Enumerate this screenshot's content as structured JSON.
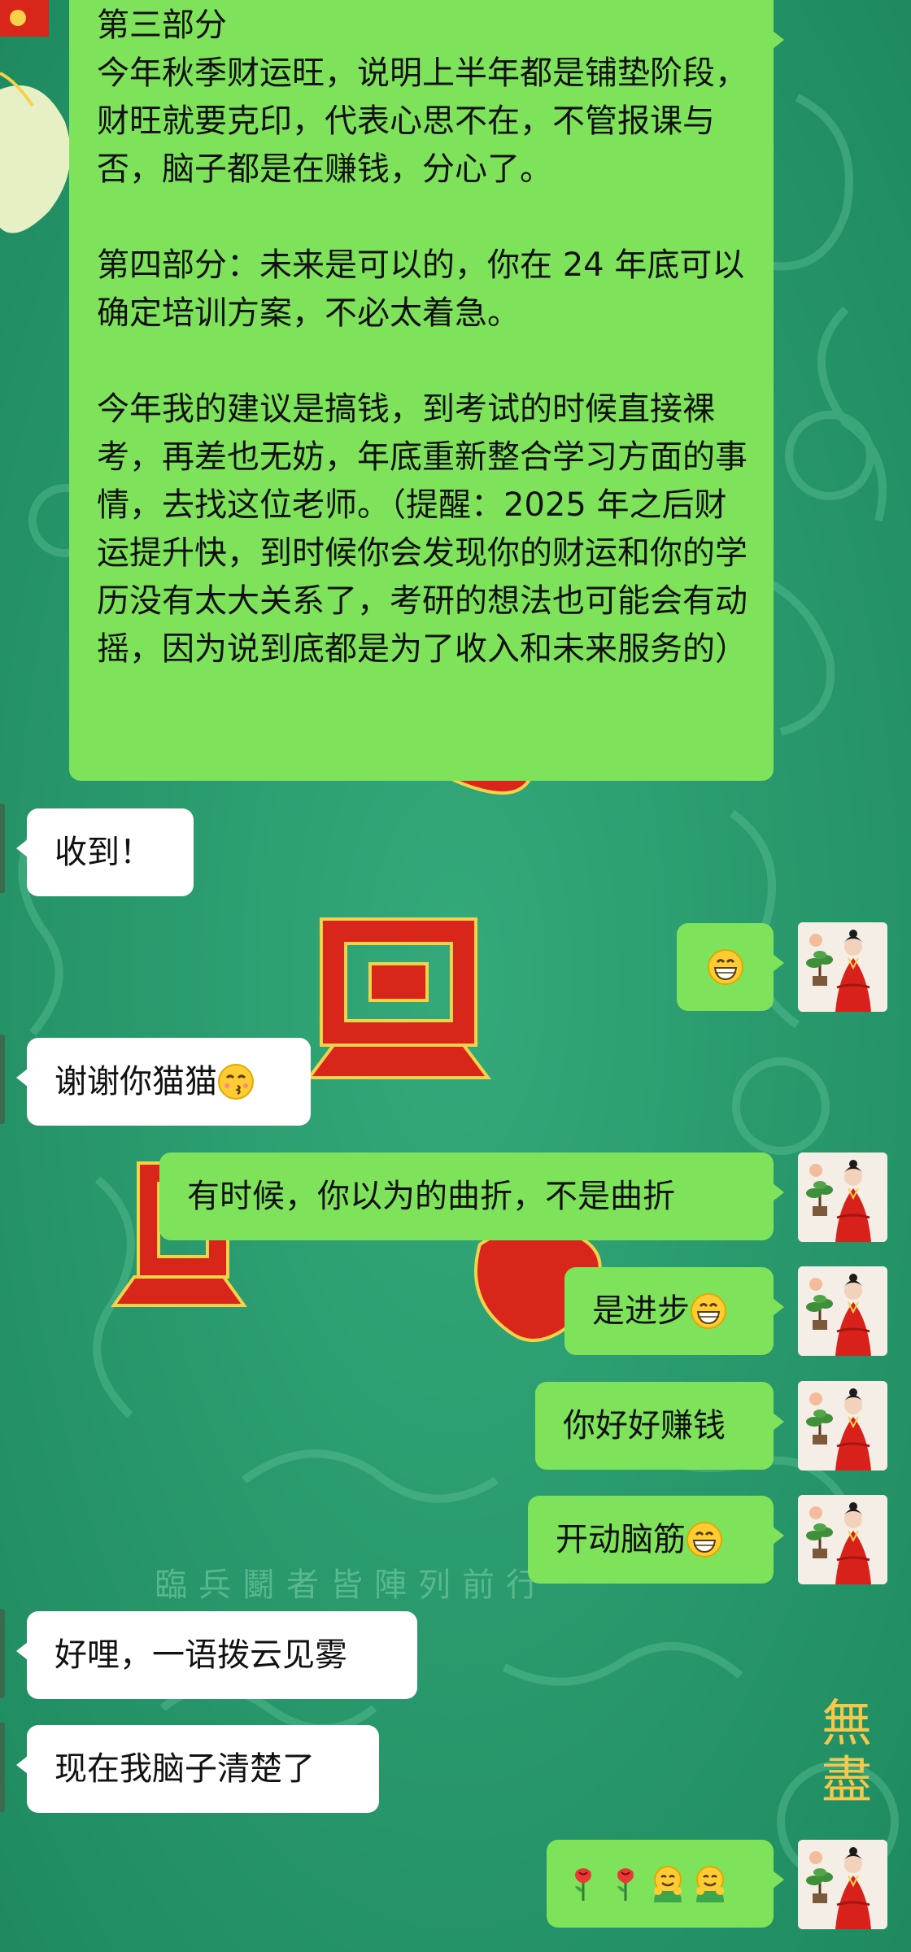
{
  "colors": {
    "wallpaper": "#2a9a6e",
    "outgoing_bubble": "#7ee35a",
    "incoming_bubble": "#ffffff",
    "wallpaper_ornament": "#d8261b"
  },
  "wallpaper_text": {
    "motto": "臨兵鬭者皆陣列前行",
    "seal": "無盡"
  },
  "messages": [
    {
      "id": "m1",
      "side": "outgoing",
      "paragraphs": [
        "第三部分\n今年秋季财运旺，说明上半年都是铺垫阶段，财旺就要克印，代表心思不在，不管报课与否，脑子都是在赚钱，分心了。",
        "第四部分：未来是可以的，你在 24 年底可以确定培训方案，不必太着急。",
        "今年我的建议是搞钱，到考试的时候直接裸考，再差也无妨，年底重新整合学习方面的事情，去找这位老师。（提醒：2025 年之后财运提升快，到时候你会发现你的财运和你的学历没有太大关系了，考研的想法也可能会有动摇，因为说到底都是为了收入和未来服务的）"
      ]
    },
    {
      "id": "m2",
      "side": "incoming",
      "text": "收到！"
    },
    {
      "id": "m3",
      "side": "outgoing",
      "text": "",
      "emojis": [
        "grinning-face"
      ]
    },
    {
      "id": "m4",
      "side": "incoming",
      "text": "谢谢你猫猫",
      "emojis": [
        "kissing-face"
      ]
    },
    {
      "id": "m5",
      "side": "outgoing",
      "text": "有时候，你以为的曲折，不是曲折"
    },
    {
      "id": "m6",
      "side": "outgoing",
      "text": "是进步",
      "emojis": [
        "grinning-face"
      ]
    },
    {
      "id": "m7",
      "side": "outgoing",
      "text": "你好好赚钱"
    },
    {
      "id": "m8",
      "side": "outgoing",
      "text": "开动脑筋",
      "emojis": [
        "grinning-face"
      ]
    },
    {
      "id": "m9",
      "side": "incoming",
      "text": "好哩，一语拨云见雾"
    },
    {
      "id": "m10",
      "side": "incoming",
      "text": "现在我脑子清楚了"
    },
    {
      "id": "m11",
      "side": "outgoing",
      "text": "",
      "emojis": [
        "rose",
        "rose",
        "hugging-face",
        "hugging-face"
      ]
    }
  ]
}
